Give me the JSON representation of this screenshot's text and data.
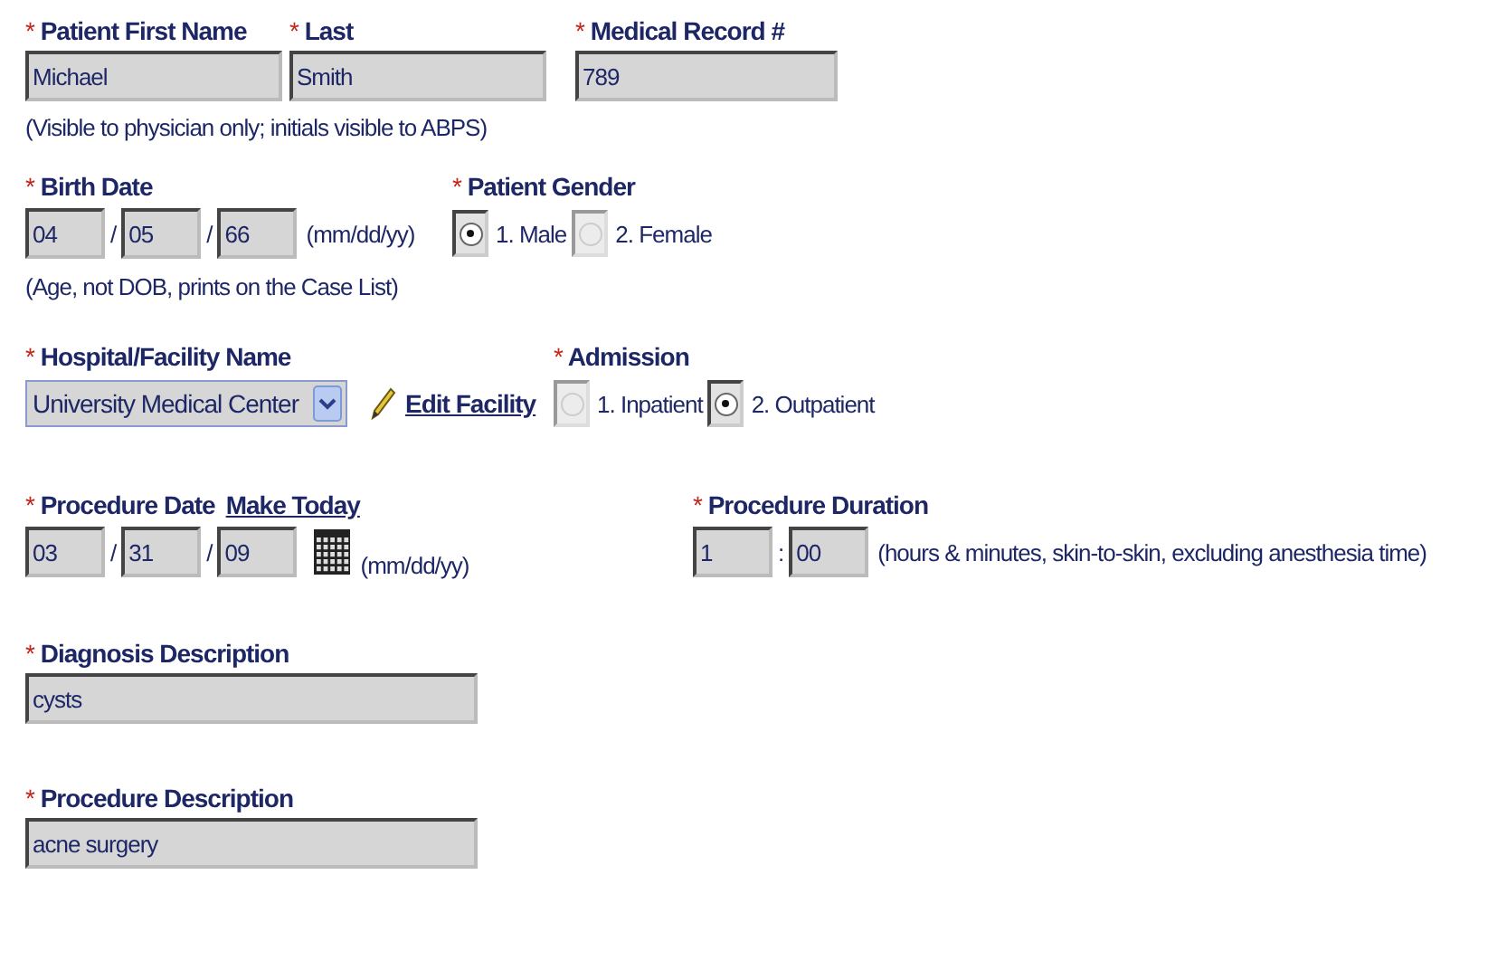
{
  "name_row": {
    "fields": [
      {
        "mark": "*",
        "label": "Patient First Name",
        "value": "Michael"
      },
      {
        "mark": "*",
        "label": "Last",
        "value": "Smith"
      },
      {
        "mark": "*",
        "label": "Medical Record #",
        "value": "789"
      }
    ],
    "note": "(Visible to physician only; initials visible to ABPS)"
  },
  "birth_date": {
    "mark": "*",
    "label": "Birth Date",
    "parts": [
      {
        "value": "04"
      },
      {
        "sep": "/",
        "value": "05"
      },
      {
        "sep": "/",
        "value": "66"
      }
    ],
    "format": "(mm/dd/yy)",
    "note": "(Age, not DOB, prints on the Case List)"
  },
  "gender": {
    "mark": "*",
    "label": "Patient Gender",
    "options": [
      {
        "label": "1. Male",
        "selected": true
      },
      {
        "label": "2. Female",
        "selected": false
      }
    ]
  },
  "facility": {
    "mark": "*",
    "label": "Hospital/Facility Name",
    "value": "University Medical Center",
    "link": "Edit Facility"
  },
  "admission": {
    "mark": "*",
    "label": "Admission",
    "options": [
      {
        "label": "1. Inpatient",
        "selected": false
      },
      {
        "label": "2. Outpatient",
        "selected": true
      }
    ]
  },
  "procedure_date": {
    "mark": "*",
    "label": "Procedure Date",
    "link": "Make Today",
    "parts": [
      {
        "value": "03"
      },
      {
        "sep": "/",
        "value": "31"
      },
      {
        "sep": "/",
        "value": "09"
      }
    ],
    "format": "(mm/dd/yy)"
  },
  "duration": {
    "mark": "*",
    "label": "Procedure Duration",
    "parts": [
      {
        "value": "1"
      },
      {
        "sep": ":",
        "value": "00"
      }
    ],
    "note": "(hours & minutes, skin-to-skin, excluding anesthesia time)"
  },
  "diagnosis": {
    "mark": "*",
    "label": "Diagnosis Description",
    "value": "cysts"
  },
  "procedure": {
    "mark": "*",
    "label": "Procedure Description",
    "value": "acne surgery"
  }
}
